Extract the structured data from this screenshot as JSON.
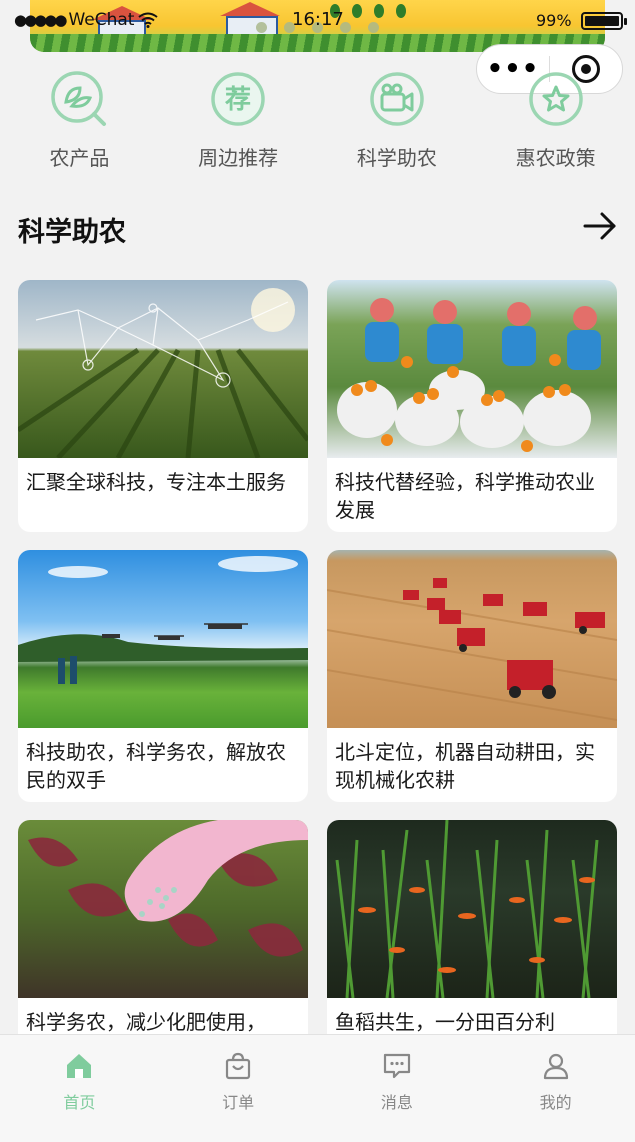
{
  "status_bar": {
    "carrier": "WeChat",
    "time": "16:17",
    "battery": "99%"
  },
  "categories": [
    {
      "label": "农产品",
      "icon": "leaf-search-icon"
    },
    {
      "label": "周边推荐",
      "icon": "recommend-icon"
    },
    {
      "label": "科学助农",
      "icon": "video-camera-icon"
    },
    {
      "label": "惠农政策",
      "icon": "star-badge-icon"
    }
  ],
  "section": {
    "title": "科学助农",
    "arrow_icon": "arrow-right-icon"
  },
  "cards": [
    {
      "caption": "汇聚全球科技，专注本土服务"
    },
    {
      "caption": "科技代替经验，科学推动农业发展"
    },
    {
      "caption": "科技助农，科学务农，解放农民的双手"
    },
    {
      "caption": "北斗定位，机器自动耕田，实现机械化农耕"
    },
    {
      "caption": "科学务农，减少化肥使用，"
    },
    {
      "caption": "鱼稻共生，一分田百分利"
    }
  ],
  "tabs": [
    {
      "label": "首页",
      "icon": "home-icon",
      "active": true
    },
    {
      "label": "订单",
      "icon": "shopping-bag-icon",
      "active": false
    },
    {
      "label": "消息",
      "icon": "message-icon",
      "active": false
    },
    {
      "label": "我的",
      "icon": "user-icon",
      "active": false
    }
  ],
  "colors": {
    "accent": "#7fcc9d",
    "tab_inactive": "#888888",
    "background": "#f2f2f2"
  }
}
